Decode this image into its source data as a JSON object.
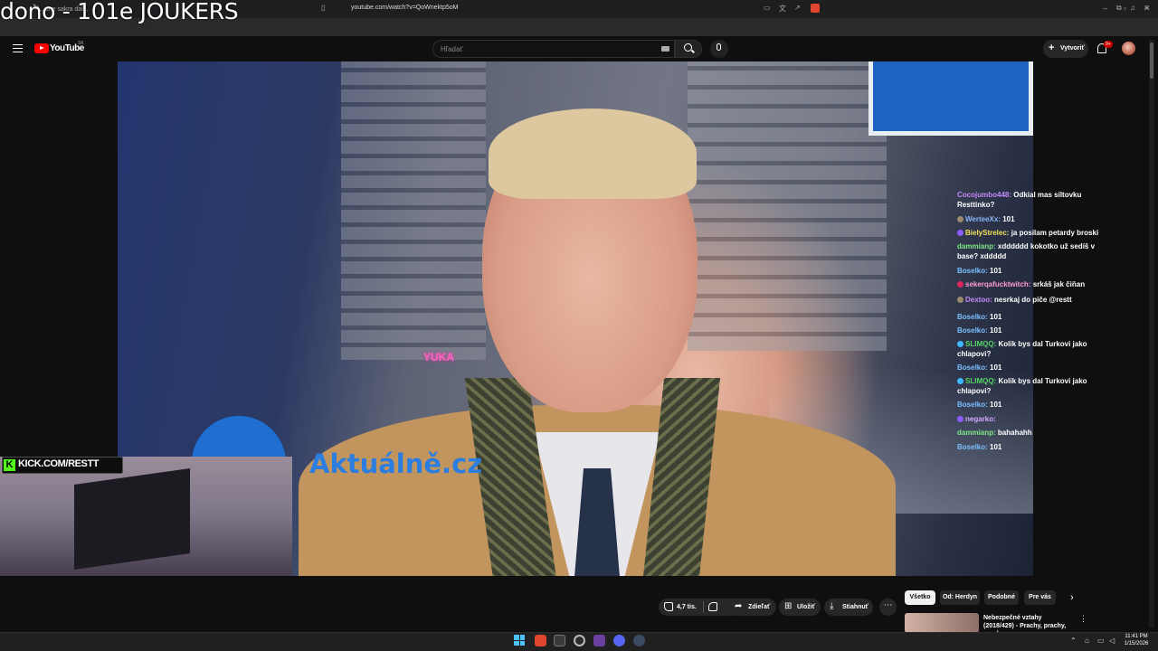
{
  "stream_overlay": {
    "title": "dono - 101e JOUKERS",
    "kick_url": "KICK.COM/RESTT",
    "kick_logo": "K"
  },
  "browser": {
    "tab_title": "...one sakra dal...",
    "url": "youtube.com/watch?v=QoWnektp5oM"
  },
  "youtube": {
    "logo_text": "YouTube",
    "region": "SK",
    "search_placeholder": "Hľadať",
    "create_label": "Vytvoriť",
    "notification_count": "9+"
  },
  "video": {
    "watermark": "Aktuálně.cz",
    "store_sign": "YUKA"
  },
  "chat": [
    {
      "user": "Cocojumbo448:",
      "text": "Odkial mas siltovku Resttinko?",
      "color": "#c58af9",
      "icon": ""
    },
    {
      "user": "WerteeXx:",
      "text": "101",
      "color": "#8ab4f8",
      "icon": "#9a8a70"
    },
    {
      "user": "BielyStrelec:",
      "text": "ja posilam petardy broski",
      "color": "#f1e05a",
      "icon": "#8f5cff"
    },
    {
      "user": "dammianp:",
      "text": "xdddddd kokotko už sedíš v base? xddddd",
      "color": "#7ee787",
      "icon": ""
    },
    {
      "user": "Boselko:",
      "text": "101",
      "color": "#79c0ff",
      "icon": ""
    },
    {
      "user": "sekerqafucktwitch:",
      "text": "srkáš jak čiňan",
      "color": "#ff9ad5",
      "icon": "#e0245e"
    },
    {
      "user": "Dextoo:",
      "text": "nesrkaj do piče @restt",
      "color": "#c58af9",
      "icon": "#9a8a70"
    },
    {
      "user": "Boselko:",
      "text": "101",
      "color": "#79c0ff",
      "icon": ""
    },
    {
      "user": "Boselko:",
      "text": "101",
      "color": "#79c0ff",
      "icon": ""
    },
    {
      "user": "SLIMQQ:",
      "text": "Kolik bys dal Turkovi jako chlapovi?",
      "color": "#56d364",
      "icon": "#3fb9ff"
    },
    {
      "user": "Boselko:",
      "text": "101",
      "color": "#79c0ff",
      "icon": ""
    },
    {
      "user": "SLIMQQ:",
      "text": "Kolik bys dal Turkovi jako chlapovi?",
      "color": "#56d364",
      "icon": "#3fb9ff"
    },
    {
      "user": "Boselko:",
      "text": "101",
      "color": "#79c0ff",
      "icon": ""
    },
    {
      "user": "negarko:",
      "text": "",
      "color": "#d2a8ff",
      "icon": "#8f5cff"
    },
    {
      "user": "dammianp:",
      "text": "bahahahh",
      "color": "#7ee787",
      "icon": ""
    },
    {
      "user": "Boselko:",
      "text": "101",
      "color": "#79c0ff",
      "icon": ""
    }
  ],
  "actions": {
    "like_count": "4,7 tis.",
    "share": "Zdieľať",
    "save": "Uložiť",
    "download": "Stiahnuť",
    "more": "⋯"
  },
  "chips": [
    "Všetko",
    "Od: Herdyn",
    "Podobné",
    "Pre vás"
  ],
  "recommendation": {
    "title": "Nebezpečné vztahy (2018/429) - Prachy, prachy, prachy",
    "more": "⋮"
  },
  "taskbar": {
    "time": "11:41 PM",
    "date": "1/15/2026"
  },
  "colors": {
    "youtube_red": "#ff0000",
    "kick_green": "#53fc18",
    "accent_blue": "#4cc2ff"
  }
}
